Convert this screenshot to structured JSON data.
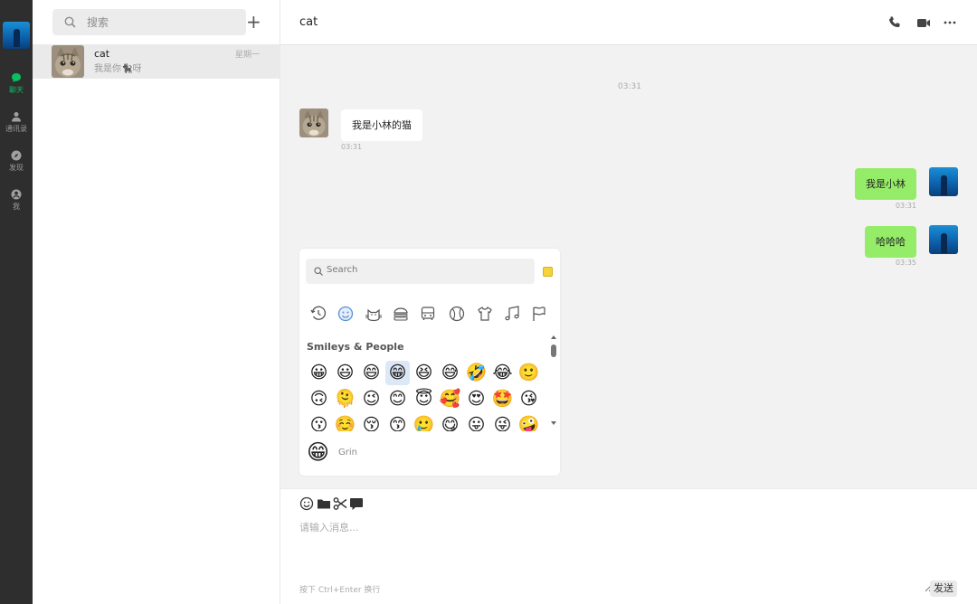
{
  "nav": {
    "items": [
      {
        "label": "聊天",
        "icon": "chat-bubble-icon",
        "active": true
      },
      {
        "label": "通讯录",
        "icon": "person-icon",
        "active": false
      },
      {
        "label": "发现",
        "icon": "compass-icon",
        "active": false
      },
      {
        "label": "我",
        "icon": "user-circle-icon",
        "active": false
      }
    ]
  },
  "list": {
    "search_placeholder": "搜索",
    "add_label": "+",
    "conversations": [
      {
        "name": "cat",
        "last_message": "我是你🐈‍⬛呀",
        "time": "星期一"
      }
    ]
  },
  "chat": {
    "title": "cat",
    "timestamp": "03:31",
    "messages": [
      {
        "direction": "in",
        "text": "我是小林的猫",
        "time": "03:31"
      },
      {
        "direction": "out",
        "text": "我是小林",
        "time": "03:31"
      },
      {
        "direction": "out",
        "text": "哈哈哈",
        "time": "03:35"
      }
    ]
  },
  "emoji_picker": {
    "search_placeholder": "Search",
    "section_title": "Smileys & People",
    "categories": [
      "clock-icon",
      "smiley-icon",
      "cat-icon",
      "burger-icon",
      "bus-icon",
      "ball-icon",
      "shirt-icon",
      "music-icon",
      "flag-icon"
    ],
    "emojis": [
      [
        "😀",
        "😃",
        "😄",
        "😁",
        "😆",
        "😅",
        "🤣",
        "😂",
        "🙂"
      ],
      [
        "🙃",
        "🫠",
        "😉",
        "😊",
        "😇",
        "🥰",
        "😍",
        "🤩",
        "😘"
      ],
      [
        "😗",
        "☺️",
        "😚",
        "😙",
        "🥲",
        "😋",
        "😛",
        "😜",
        "🤪"
      ]
    ],
    "selected_emoji": "😁",
    "preview_name": "Grin"
  },
  "composer": {
    "placeholder": "请输入消息...",
    "hint": "按下 Ctrl+Enter 换行",
    "send_label": "发送",
    "tools": [
      "smiley-icon",
      "folder-icon",
      "scissors-icon",
      "comment-icon"
    ]
  },
  "colors": {
    "accent": "#07c160",
    "bubble_out": "#95ec69",
    "nav_bg": "#2e2e2e"
  }
}
